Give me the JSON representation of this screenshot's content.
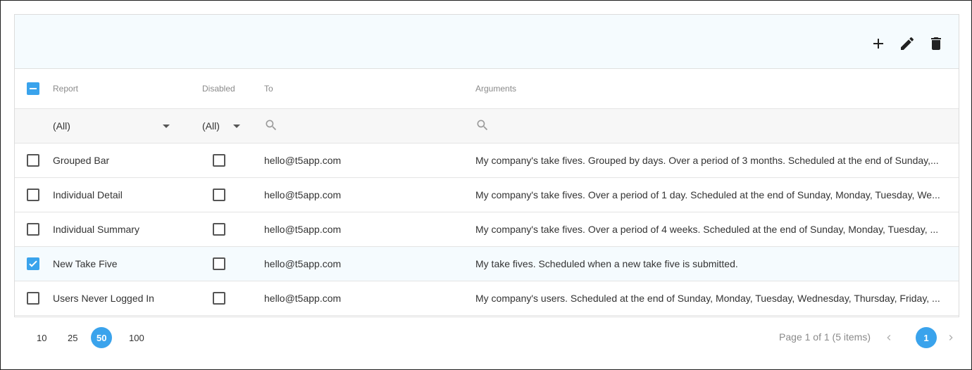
{
  "toolbar": {
    "add_icon": "plus-icon",
    "edit_icon": "pencil-icon",
    "delete_icon": "trash-icon"
  },
  "columns": {
    "report": "Report",
    "disabled": "Disabled",
    "to": "To",
    "arguments": "Arguments"
  },
  "filters": {
    "report": "(All)",
    "disabled": "(All)"
  },
  "rows": [
    {
      "selected": false,
      "report": "Grouped Bar",
      "disabled": false,
      "to": "hello@t5app.com",
      "arguments": "My company's take fives. Grouped by days. Over a period of 3 months. Scheduled at the end of Sunday,..."
    },
    {
      "selected": false,
      "report": "Individual Detail",
      "disabled": false,
      "to": "hello@t5app.com",
      "arguments": "My company's take fives. Over a period of 1 day. Scheduled at the end of Sunday, Monday, Tuesday, We..."
    },
    {
      "selected": false,
      "report": "Individual Summary",
      "disabled": false,
      "to": "hello@t5app.com",
      "arguments": "My company's take fives. Over a period of 4 weeks. Scheduled at the end of Sunday, Monday, Tuesday, ..."
    },
    {
      "selected": true,
      "report": "New Take Five",
      "disabled": false,
      "to": "hello@t5app.com",
      "arguments": "My take fives. Scheduled when a new take five is submitted."
    },
    {
      "selected": false,
      "report": "Users Never Logged In",
      "disabled": false,
      "to": "hello@t5app.com",
      "arguments": "My company's users. Scheduled at the end of Sunday, Monday, Tuesday, Wednesday, Thursday, Friday, ..."
    }
  ],
  "pager": {
    "sizes": [
      "10",
      "25",
      "50",
      "100"
    ],
    "active_size": "50",
    "info": "Page 1 of 1 (5 items)",
    "current_page": "1"
  },
  "colors": {
    "accent": "#3aa3ec",
    "toolbar_bg": "#f5fbfe"
  }
}
